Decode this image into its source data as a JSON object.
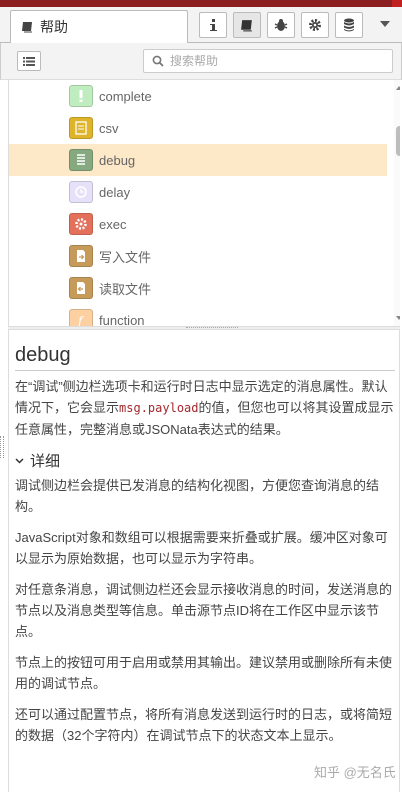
{
  "header": {
    "tab_label": "帮助",
    "buttons": [
      {
        "name": "info-tab-button",
        "icon": "info-icon"
      },
      {
        "name": "help-tab-button",
        "icon": "book-icon"
      },
      {
        "name": "debug-tab-button",
        "icon": "bug-icon"
      },
      {
        "name": "config-tab-button",
        "icon": "gear-icon"
      },
      {
        "name": "context-tab-button",
        "icon": "database-icon"
      }
    ]
  },
  "toolbar": {
    "search_placeholder": "搜索帮助"
  },
  "tree": {
    "items": [
      {
        "label": "complete",
        "color": "#c0edc0",
        "icon": "exclamation-icon"
      },
      {
        "label": "csv",
        "color": "#deb42b",
        "icon": "csv-icon"
      },
      {
        "label": "debug",
        "color": "#87a980",
        "icon": "list-icon"
      },
      {
        "label": "delay",
        "color": "#e6e0f8",
        "icon": "timer-icon"
      },
      {
        "label": "exec",
        "color": "#e2705a",
        "icon": "cog-icon"
      },
      {
        "label": "写入文件",
        "color": "#c69a59",
        "icon": "file-out-icon"
      },
      {
        "label": "读取文件",
        "color": "#c69a59",
        "icon": "file-in-icon"
      },
      {
        "label": "function",
        "color": "#fdd0a2",
        "icon": "function-icon"
      }
    ],
    "selected": "debug"
  },
  "doc": {
    "title": "debug",
    "intro_a": "在“调试”侧边栏选项卡和运行时日志中显示选定的消息属性。默认情况下，它会显示",
    "intro_code": "msg.payload",
    "intro_b": "的值，但您也可以将其设置成显示任意属性，完整消息或JSONata表达式的结果。",
    "section_title": "详细",
    "p1": "调试侧边栏会提供已发消息的结构化视图，方便您查询消息的结构。",
    "p2": "JavaScript对象和数组可以根据需要来折叠或扩展。缓冲区对象可以显示为原始数据，也可以显示为字符串。",
    "p3": "对任意条消息，调试侧边栏还会显示接收消息的时间，发送消息的节点以及消息类型等信息。单击源节点ID将在工作区中显示该节点。",
    "p4": "节点上的按钮可用于启用或禁用其输出。建议禁用或删除所有未使用的调试节点。",
    "p5": "还可以通过配置节点，将所有消息发送到运行时的日志，或将简短的数据（32个字符内）在调试节点下的状态文本上显示。"
  },
  "watermark": "知乎 @无名氏"
}
